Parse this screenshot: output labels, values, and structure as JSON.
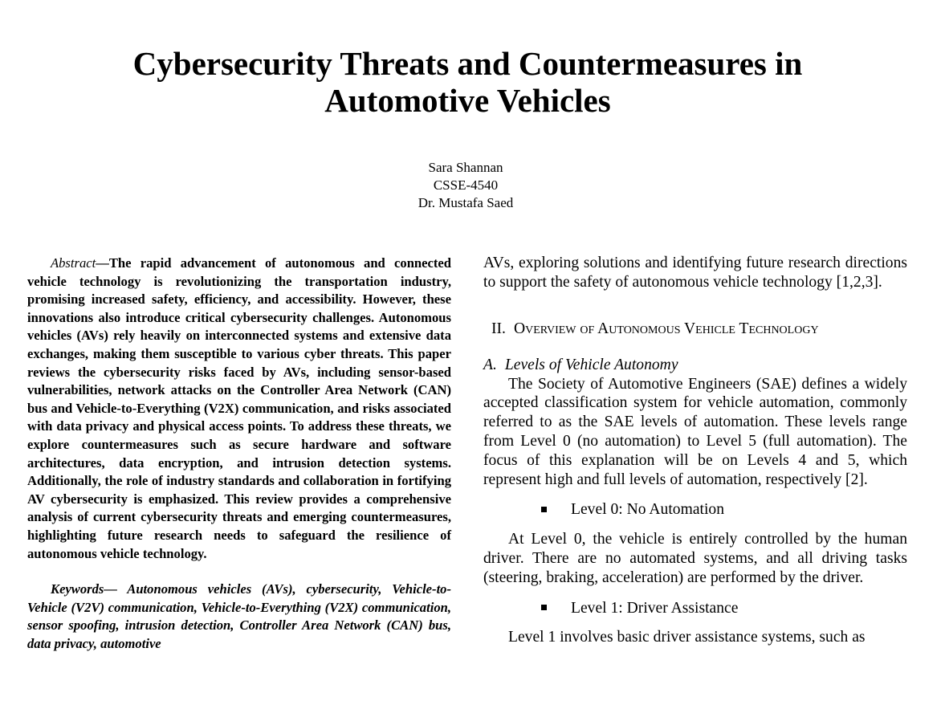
{
  "paper": {
    "title_line1": "Cybersecurity Threats and Countermeasures in",
    "title_line2": "Automotive Vehicles",
    "author": "Sara Shannan",
    "course": "CSSE-4540",
    "instructor": "Dr. Mustafa Saed"
  },
  "abstract": {
    "lead": "Abstract",
    "text": "—The rapid advancement of autonomous and connected vehicle technology is revolutionizing the transportation industry, promising increased safety, efficiency, and accessibility. However, these innovations also introduce critical cybersecurity challenges. Autonomous vehicles (AVs) rely heavily on interconnected systems and extensive data exchanges, making them susceptible to various cyber threats. This paper reviews the cybersecurity risks faced by AVs, including sensor-based vulnerabilities, network attacks on the Controller Area Network (CAN) bus and Vehicle-to-Everything (V2X) communication, and risks associated with data privacy and physical access points. To address these threats, we explore countermeasures such as secure hardware and software architectures, data encryption, and intrusion detection systems. Additionally, the role of industry standards and collaboration in fortifying AV cybersecurity is emphasized. This review provides a comprehensive analysis of current cybersecurity threats and emerging countermeasures, highlighting future research needs to safeguard the resilience of autonomous vehicle technology."
  },
  "keywords": {
    "lead": "Keywords—",
    "text": " Autonomous vehicles (AVs), cybersecurity, Vehicle-to-Vehicle (V2V) communication, Vehicle-to-Everything (V2X) communication, sensor spoofing, intrusion detection, Controller Area Network (CAN) bus, data privacy, automotive"
  },
  "right": {
    "intro_cont": "AVs, exploring solutions and identifying future research directions to support the safety of autonomous vehicle technology [1,2,3].",
    "section_num": "II.",
    "section_title": "Overview of Autonomous Vehicle Technology",
    "sub_letter": "A.",
    "sub_title": "Levels of Vehicle Autonomy",
    "para_sae": "The Society of Automotive Engineers (SAE) defines a widely accepted classification system for vehicle automation, commonly referred to as the SAE levels of automation. These levels range from Level 0 (no automation) to Level 5 (full automation). The focus of this explanation will be on Levels 4 and 5, which represent high and full levels of automation, respectively [2].",
    "bullet0": "Level 0: No Automation",
    "para_level0": "At Level 0, the vehicle is entirely controlled by the human driver. There are no automated systems, and all driving tasks (steering, braking, acceleration) are performed by the driver.",
    "bullet1": "Level 1: Driver Assistance",
    "para_level1": "Level 1 involves basic driver assistance systems, such as"
  }
}
